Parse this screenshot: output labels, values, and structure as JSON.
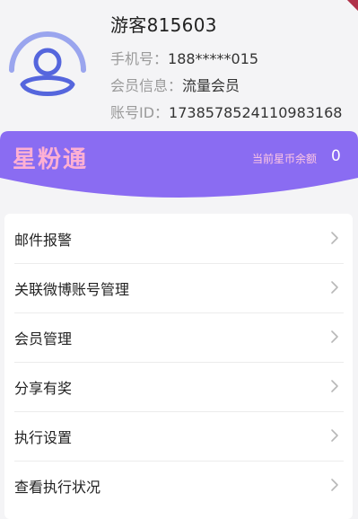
{
  "profile": {
    "name": "游客815603",
    "phone_label": "手机号：",
    "phone_value": "188*****015",
    "member_label": "会员信息：",
    "member_value": "流量会员",
    "account_label": "账号ID：",
    "account_value": "1738578524110983168"
  },
  "banner": {
    "brand": "星粉通",
    "balance_label": "当前星币余额",
    "balance_value": "0"
  },
  "menu": {
    "items": [
      {
        "label": "邮件报警"
      },
      {
        "label": "关联微博账号管理"
      },
      {
        "label": "会员管理"
      },
      {
        "label": "分享有奖"
      },
      {
        "label": "执行设置"
      },
      {
        "label": "查看执行状况"
      }
    ]
  },
  "icons": {
    "avatar": "user-avatar-icon",
    "chevron": "chevron-right-icon"
  },
  "colors": {
    "accent": "#8a6cf2",
    "avatar_blue": "#5566dd",
    "brand_pink": "#ffb0d3"
  }
}
